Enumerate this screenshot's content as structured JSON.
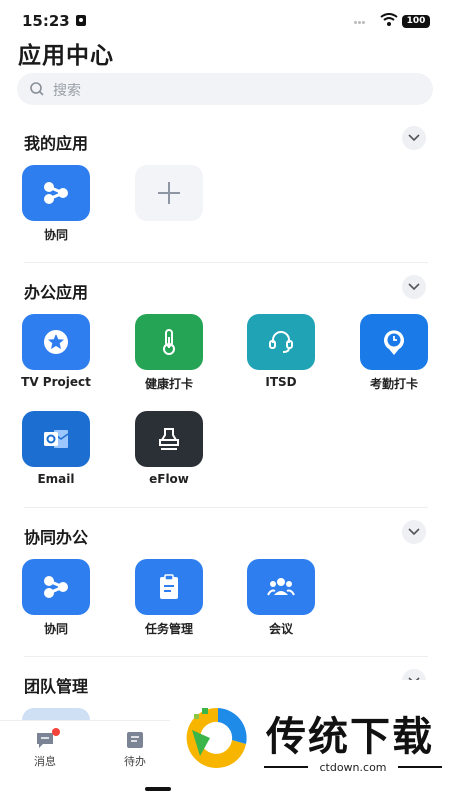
{
  "status": {
    "time": "15:23",
    "battery": "100"
  },
  "page_title": "应用中心",
  "search": {
    "placeholder": "搜索"
  },
  "sections": {
    "my_apps": {
      "title": "我的应用",
      "apps": [
        {
          "label": "协同",
          "icon": "collab-icon",
          "color": "#2f7ef0"
        },
        {
          "label": "",
          "icon": "plus-icon",
          "color": "#f2f4f8"
        }
      ]
    },
    "office_apps": {
      "title": "办公应用",
      "apps": [
        {
          "label": "TV Project",
          "icon": "star-badge-icon",
          "color": "#2f7ef0"
        },
        {
          "label": "健康打卡",
          "icon": "thermometer-icon",
          "color": "#25a455"
        },
        {
          "label": "ITSD",
          "icon": "headset-icon",
          "color": "#1fa3b5"
        },
        {
          "label": "考勤打卡",
          "icon": "clock-pin-icon",
          "color": "#1a7be8"
        },
        {
          "label": "Email",
          "icon": "outlook-icon",
          "color": "#1c6fd1"
        },
        {
          "label": "eFlow",
          "icon": "stamp-icon",
          "color": "#2b2f36"
        }
      ]
    },
    "collab_office": {
      "title": "协同办公",
      "apps": [
        {
          "label": "协同",
          "icon": "collab-icon",
          "color": "#2f7ef0"
        },
        {
          "label": "任务管理",
          "icon": "clipboard-icon",
          "color": "#2f7ef0"
        },
        {
          "label": "会议",
          "icon": "meeting-icon",
          "color": "#2f7ef0"
        }
      ]
    },
    "team_mgmt": {
      "title": "团队管理"
    }
  },
  "tabbar": {
    "messages": "消息",
    "todo": "待办"
  },
  "watermark": {
    "title": "传统下载",
    "domain": "ctdown.com"
  }
}
